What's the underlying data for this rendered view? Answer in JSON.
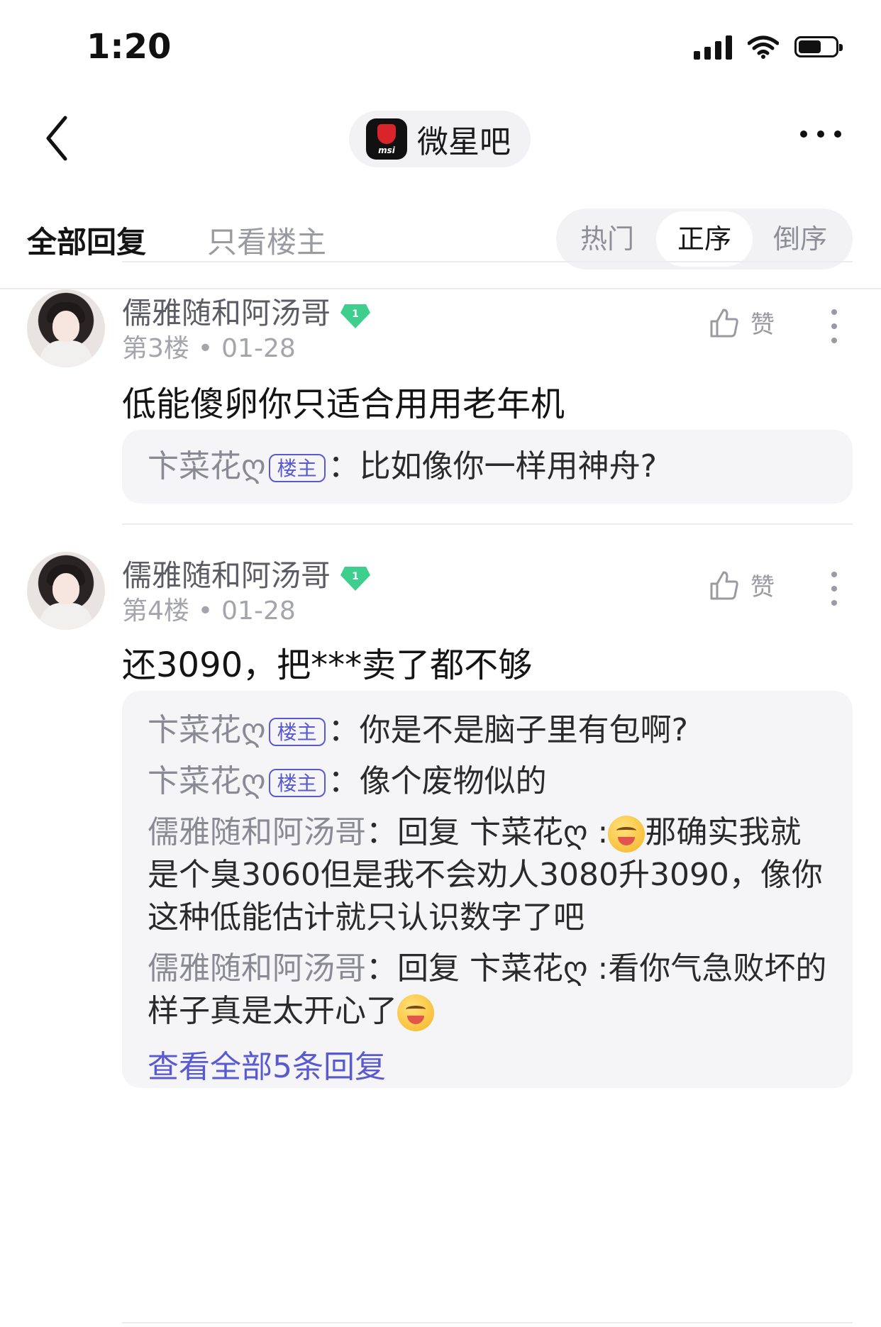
{
  "status_bar": {
    "time": "1:20"
  },
  "nav": {
    "forum_name": "微星吧",
    "logo_text": "msi"
  },
  "tabs": {
    "all_replies": "全部回复",
    "op_only": "只看楼主"
  },
  "sort": {
    "hot": "热门",
    "asc": "正序",
    "desc": "倒序",
    "selected": "正序"
  },
  "posts": [
    {
      "username": "儒雅随和阿汤哥",
      "level": "1",
      "floor": "第3楼",
      "date": "01-28",
      "like_label": "赞",
      "content": "低能傻卵你只适合用用老年机",
      "replies": [
        {
          "author": "卞菜花ღ",
          "badge": "楼主",
          "sep": "：",
          "text": "比如像你一样用神舟?"
        }
      ]
    },
    {
      "username": "儒雅随和阿汤哥",
      "level": "1",
      "floor": "第4楼",
      "date": "01-28",
      "like_label": "赞",
      "content": "还3090，把***卖了都不够",
      "replies": [
        {
          "author": "卞菜花ღ",
          "badge": "楼主",
          "sep": "：",
          "text": "你是不是脑子里有包啊?"
        },
        {
          "author": "卞菜花ღ",
          "badge": "楼主",
          "sep": "：",
          "text": "像个废物似的"
        },
        {
          "author": "儒雅随和阿汤哥",
          "sep": "：",
          "text_before": "回复 卞菜花ღ :",
          "text_after": "那确实我就是个臭3060但是我不会劝人3080升3090，像你这种低能估计就只认识数字了吧"
        },
        {
          "author": "儒雅随和阿汤哥",
          "sep": "：",
          "text_before": "回复 卞菜花ღ :看你气急败坏的样子真是太开心了",
          "text_after": ""
        }
      ],
      "view_all": "查看全部5条回复"
    }
  ],
  "colors": {
    "accent": "#5a5ad0",
    "gem": "#3ecf8e"
  }
}
